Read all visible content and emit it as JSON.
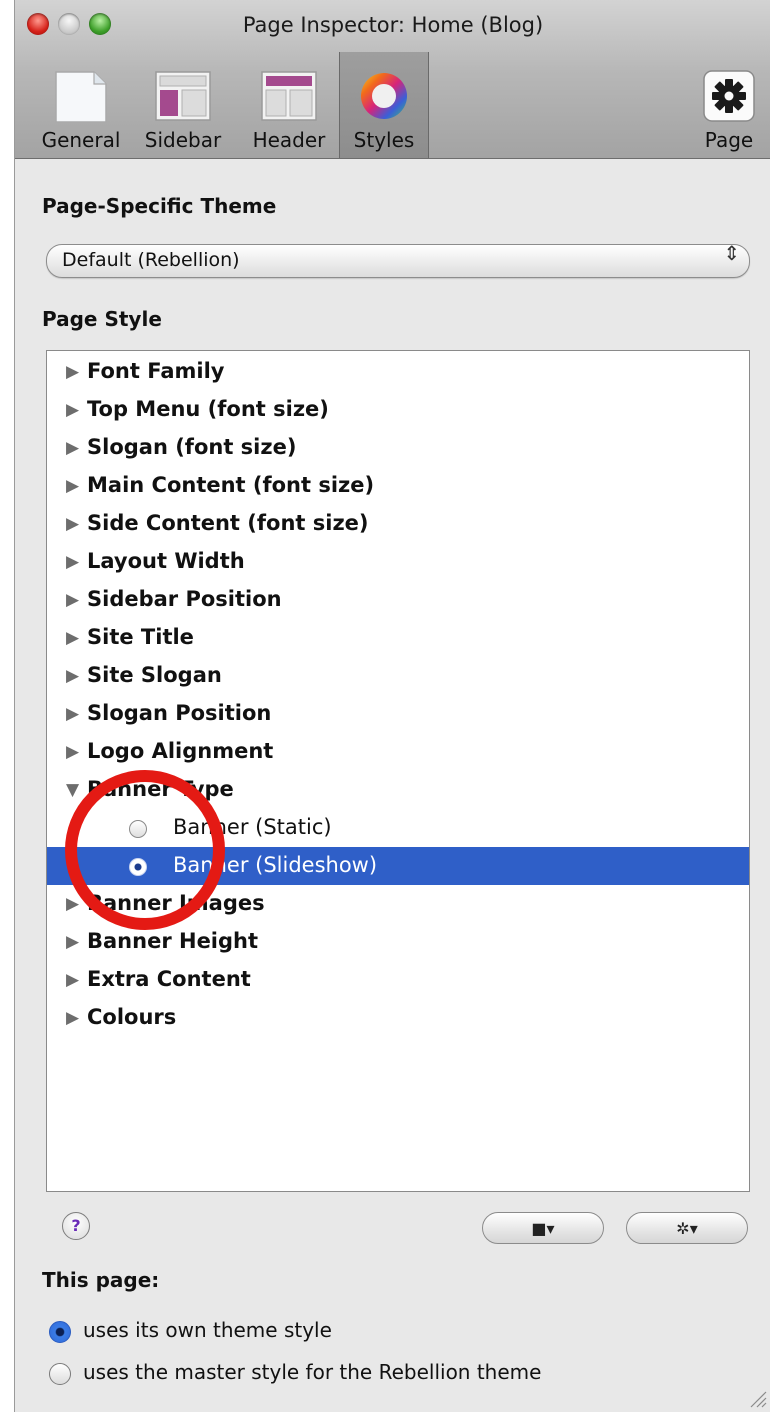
{
  "window": {
    "title": "Page Inspector: Home (Blog)"
  },
  "toolbar": {
    "tabs": [
      {
        "label": "General",
        "icon": "blank-page-icon"
      },
      {
        "label": "Sidebar",
        "icon": "sidebar-layout-icon"
      },
      {
        "label": "Header",
        "icon": "header-layout-icon"
      },
      {
        "label": "Styles",
        "icon": "color-wheel-icon",
        "selected": true
      }
    ],
    "page_button": {
      "label": "Page",
      "icon": "gear-icon"
    }
  },
  "theme": {
    "section_title": "Page-Specific Theme",
    "selected": "Default (Rebellion)",
    "arrows": "⇕"
  },
  "style": {
    "section_title": "Page Style",
    "items": [
      {
        "label": "Font Family",
        "expanded": false
      },
      {
        "label": "Top Menu (font size)",
        "expanded": false
      },
      {
        "label": "Slogan (font size)",
        "expanded": false
      },
      {
        "label": "Main Content (font size)",
        "expanded": false
      },
      {
        "label": "Side Content (font size)",
        "expanded": false
      },
      {
        "label": "Layout Width",
        "expanded": false
      },
      {
        "label": "Sidebar Position",
        "expanded": false
      },
      {
        "label": "Site Title",
        "expanded": false
      },
      {
        "label": "Site Slogan",
        "expanded": false
      },
      {
        "label": "Slogan Position",
        "expanded": false
      },
      {
        "label": "Logo Alignment",
        "expanded": false
      },
      {
        "label": "Banner Type",
        "expanded": true
      },
      {
        "label": "Banner (Static)",
        "child": true,
        "checked": false
      },
      {
        "label": "Banner (Slideshow)",
        "child": true,
        "checked": true,
        "selected": true
      },
      {
        "label": "Banner Images",
        "expanded": false
      },
      {
        "label": "Banner Height",
        "expanded": false
      },
      {
        "label": "Extra Content",
        "expanded": false
      },
      {
        "label": "Colours",
        "expanded": false
      }
    ]
  },
  "buttons": {
    "help": "?"
  },
  "this_page": {
    "title": "This page:",
    "options": [
      {
        "label": "uses its own theme style",
        "checked": true
      },
      {
        "label": "uses the master style for the Rebellion theme",
        "checked": false
      }
    ]
  },
  "colors": {
    "selection": "#2f5fc8",
    "annotation": "#e41a14"
  }
}
